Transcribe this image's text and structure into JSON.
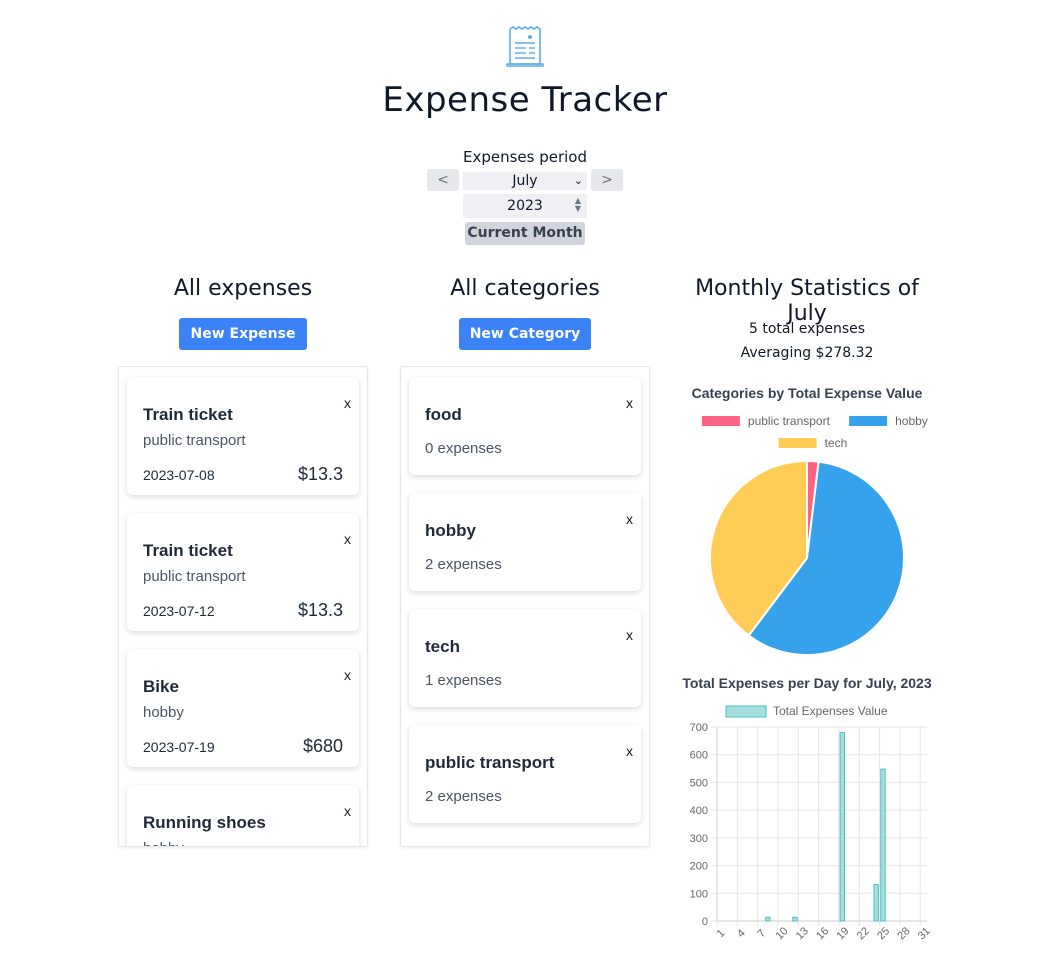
{
  "app": {
    "title": "Expense Tracker",
    "icon": "receipt-icon"
  },
  "period": {
    "label": "Expenses period",
    "prev_label": "<",
    "next_label": ">",
    "month": "July",
    "year": "2023",
    "current_month_label": "Current Month"
  },
  "expenses": {
    "title": "All expenses",
    "new_label": "New Expense",
    "close_label": "x",
    "items": [
      {
        "name": "Train ticket",
        "category": "public transport",
        "date": "2023-07-08",
        "amount": "$13.3"
      },
      {
        "name": "Train ticket",
        "category": "public transport",
        "date": "2023-07-12",
        "amount": "$13.3"
      },
      {
        "name": "Bike",
        "category": "hobby",
        "date": "2023-07-19",
        "amount": "$680"
      },
      {
        "name": "Running shoes",
        "category": "hobby",
        "date": "",
        "amount": ""
      }
    ]
  },
  "categories": {
    "title": "All categories",
    "new_label": "New Category",
    "close_label": "x",
    "items": [
      {
        "name": "food",
        "count": "0 expenses"
      },
      {
        "name": "hobby",
        "count": "2 expenses"
      },
      {
        "name": "tech",
        "count": "1 expenses"
      },
      {
        "name": "public transport",
        "count": "2 expenses"
      }
    ]
  },
  "stats": {
    "title": "Monthly Statistics of July",
    "total_line": "5 total expenses",
    "average_line": "Averaging $278.32"
  },
  "colors": {
    "primary": "#3b82f6",
    "public_transport": "#ff6384",
    "hobby": "#36a2eb",
    "tech": "#ffcd56",
    "bar_fill": "#a5dfdf",
    "bar_border": "#4bc0c0"
  },
  "chart_data": [
    {
      "type": "pie",
      "title": "Categories by Total Expense Value",
      "legend_position": "top",
      "labels": [
        "public transport",
        "hobby",
        "tech"
      ],
      "values": [
        26.6,
        812,
        552.99
      ],
      "colors": [
        "#ff6384",
        "#36a2eb",
        "#ffcd56"
      ]
    },
    {
      "type": "bar",
      "title": "Total Expenses per Day for July, 2023",
      "legend_position": "top",
      "series": [
        {
          "name": "Total Expenses Value",
          "x": [
            8,
            12,
            19,
            24,
            25
          ],
          "values": [
            13.3,
            13.3,
            680,
            132,
            548
          ]
        }
      ],
      "x_range": [
        1,
        31
      ],
      "x_ticks": [
        "1",
        "4",
        "7",
        "10",
        "13",
        "16",
        "19",
        "22",
        "25",
        "28",
        "31"
      ],
      "y_ticks": [
        "0",
        "100",
        "200",
        "300",
        "400",
        "500",
        "600",
        "700"
      ],
      "ylim": [
        0,
        700
      ],
      "grid": true
    }
  ]
}
